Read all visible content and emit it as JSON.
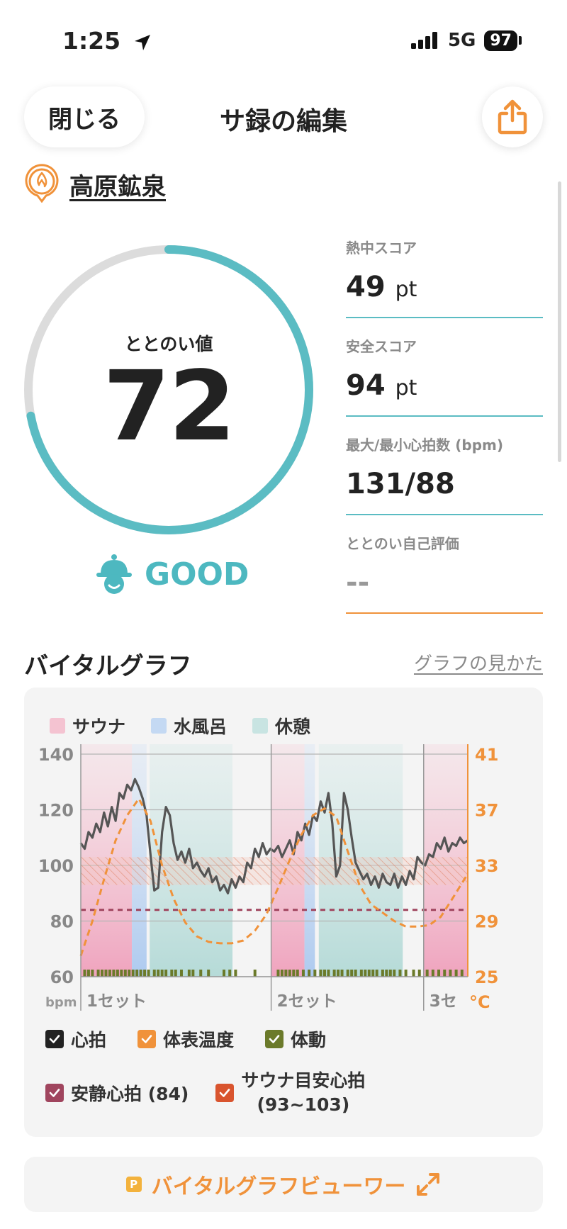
{
  "status_bar": {
    "time": "1:25",
    "network": "5G",
    "battery": "97"
  },
  "header": {
    "close_label": "閉じる",
    "title": "サ録の編集"
  },
  "facility": {
    "name": "高原鉱泉"
  },
  "gauge": {
    "label": "ととのい値",
    "value": "72",
    "progress": 0.72,
    "rating": "GOOD"
  },
  "stats": [
    {
      "label": "熱中スコア",
      "value": "49",
      "unit": "pt"
    },
    {
      "label": "安全スコア",
      "value": "94",
      "unit": "pt"
    },
    {
      "label": "最大/最小心拍数 (bpm)",
      "value": "131/88",
      "unit": ""
    },
    {
      "label": "ととのい自己評価",
      "value": "--",
      "unit": ""
    }
  ],
  "graph_section": {
    "title": "バイタルグラフ",
    "help_link": "グラフの見かた"
  },
  "graph": {
    "legend": [
      {
        "label": "サウナ",
        "color": "#f4c3d1"
      },
      {
        "label": "水風呂",
        "color": "#c4d9f3"
      },
      {
        "label": "休憩",
        "color": "#c8e4e2"
      }
    ],
    "left_axis": {
      "ticks": [
        "140",
        "120",
        "100",
        "80",
        "60"
      ],
      "unit": "bpm"
    },
    "right_axis": {
      "ticks": [
        "41",
        "37",
        "33",
        "29",
        "25"
      ],
      "unit": "°C"
    },
    "set_labels": [
      "1セット",
      "2セット",
      "3セ"
    ],
    "checks": [
      {
        "label": "心拍",
        "color": "#222222"
      },
      {
        "label": "体表温度",
        "color": "#f0923a"
      },
      {
        "label": "体動",
        "color": "#6b7a2a"
      },
      {
        "label": "安静心拍 (84)",
        "color": "#a0455e"
      },
      {
        "label": "サウナ目安心拍",
        "label2": "(93~103)",
        "color": "#d9542e"
      }
    ]
  },
  "chart_data": {
    "type": "line",
    "x_unit": "",
    "heart_rate": {
      "x": [
        0,
        1,
        2,
        3,
        4,
        5,
        6,
        7,
        8,
        9,
        10,
        11,
        12,
        13,
        14,
        15,
        16,
        17,
        18,
        19,
        20,
        21,
        22,
        23,
        24,
        25,
        26,
        27,
        28,
        29,
        30,
        31,
        32,
        33,
        34,
        35,
        36,
        37,
        38,
        39,
        40,
        41,
        42,
        43,
        44,
        45,
        46,
        47,
        48,
        49,
        50,
        51,
        52,
        53,
        54,
        55,
        56,
        57,
        58,
        59,
        60,
        61,
        62,
        63,
        64,
        65,
        66,
        67,
        68,
        69,
        70,
        71,
        72,
        73,
        74,
        75,
        76,
        77,
        78,
        79,
        80,
        81,
        82,
        83,
        84,
        85,
        86,
        87,
        88,
        89,
        90,
        91,
        92,
        93,
        94,
        95,
        96,
        97,
        98,
        99,
        100
      ],
      "values": [
        108,
        106,
        112,
        110,
        115,
        112,
        119,
        114,
        121,
        116,
        126,
        124,
        129,
        127,
        131,
        128,
        124,
        118,
        104,
        91,
        92,
        112,
        121,
        118,
        108,
        102,
        105,
        101,
        106,
        99,
        101,
        98,
        96,
        99,
        94,
        96,
        91,
        93,
        90,
        95,
        92,
        96,
        94,
        101,
        99,
        106,
        103,
        108,
        104,
        106,
        105,
        107,
        103,
        106,
        109,
        104,
        112,
        109,
        115,
        111,
        118,
        116,
        123,
        119,
        126,
        115,
        96,
        100,
        126,
        120,
        110,
        101,
        98,
        95,
        97,
        93,
        96,
        92,
        97,
        94,
        93,
        97,
        92,
        96,
        93,
        98,
        95,
        103,
        101,
        100,
        104,
        103,
        108,
        106,
        110,
        105,
        108,
        107,
        110,
        108,
        109
      ]
    },
    "skin_temp": {
      "x": [
        0,
        3,
        6,
        9,
        12,
        15,
        18,
        21,
        24,
        27,
        30,
        33,
        36,
        39,
        42,
        45,
        48,
        51,
        54,
        57,
        60,
        63,
        66,
        69,
        72,
        75,
        78,
        81,
        84,
        87,
        90,
        93,
        96,
        100
      ],
      "values": [
        26.5,
        29.0,
        32.0,
        34.8,
        36.6,
        37.8,
        36.2,
        33.0,
        30.6,
        28.9,
        27.9,
        27.5,
        27.4,
        27.4,
        27.6,
        28.3,
        29.5,
        31.4,
        33.4,
        35.2,
        36.6,
        37.1,
        36.5,
        34.0,
        31.6,
        30.2,
        29.6,
        29.0,
        28.6,
        28.6,
        28.7,
        29.3,
        30.6,
        32.4
      ]
    },
    "resting_hr": 84,
    "target_hr": [
      93,
      103
    ],
    "phases": [
      {
        "type": "sauna",
        "from": 0,
        "to": 13.2
      },
      {
        "type": "cold",
        "from": 13.2,
        "to": 17.0
      },
      {
        "type": "rest",
        "from": 17.8,
        "to": 39.2
      },
      {
        "type": "sauna",
        "from": 49.2,
        "to": 57.8
      },
      {
        "type": "cold",
        "from": 57.8,
        "to": 60.5
      },
      {
        "type": "rest",
        "from": 61.5,
        "to": 83.2
      },
      {
        "type": "sauna",
        "from": 88.6,
        "to": 100
      }
    ],
    "set_dividers": [
      49.2,
      88.6
    ],
    "ylim_left": [
      60,
      140
    ],
    "ylim_right": [
      25,
      41
    ]
  },
  "viewer_button": {
    "label": "バイタルグラフビューワー",
    "badge": "P"
  }
}
